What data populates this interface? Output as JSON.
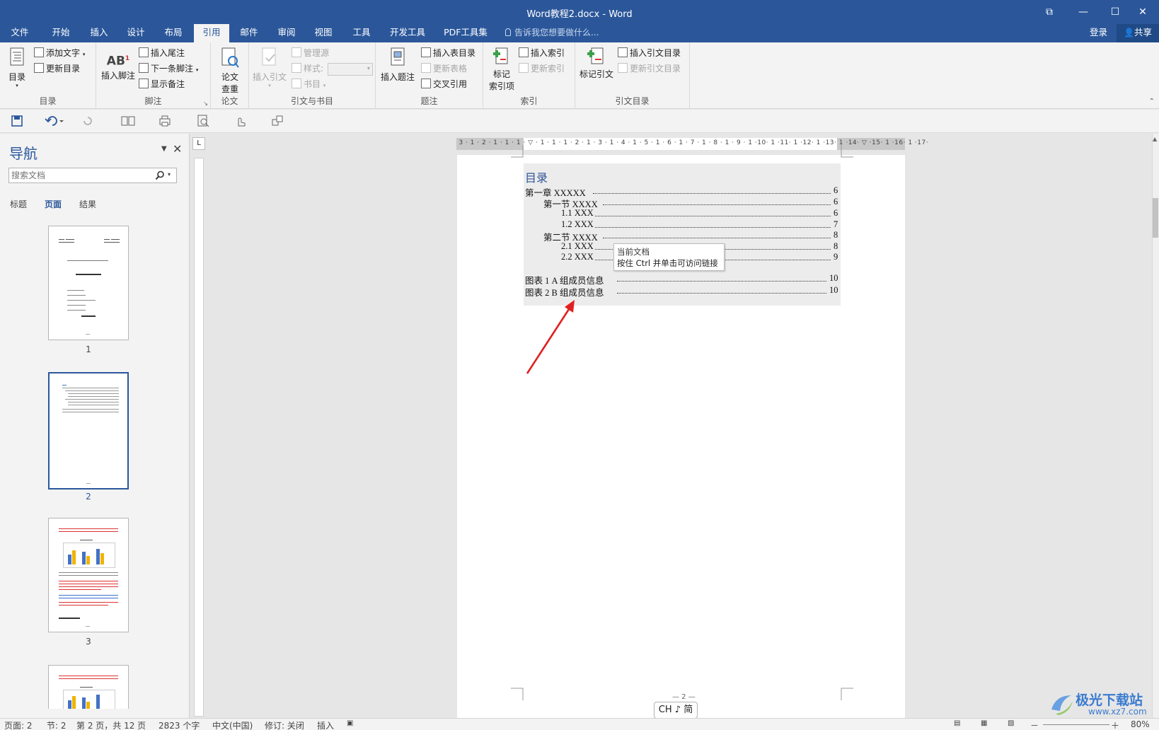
{
  "window": {
    "title": "Word教程2.docx - Word",
    "buttons": {
      "ribbon_display": "⧉",
      "minimize": "—",
      "maximize": "☐",
      "close": "✕"
    }
  },
  "tabs": [
    {
      "label": "文件"
    },
    {
      "label": "开始"
    },
    {
      "label": "插入"
    },
    {
      "label": "设计"
    },
    {
      "label": "布局"
    },
    {
      "label": "引用"
    },
    {
      "label": "邮件"
    },
    {
      "label": "审阅"
    },
    {
      "label": "视图"
    },
    {
      "label": "工具"
    },
    {
      "label": "开发工具"
    },
    {
      "label": "PDF工具集"
    }
  ],
  "active_tab": "引用",
  "tell_me": "告诉我您想要做什么...",
  "login": "登录",
  "share": "共享",
  "ribbon": {
    "toc": {
      "group": "目录",
      "toc_btn": "目录",
      "add_text": "添加文字",
      "update_toc": "更新目录"
    },
    "footnotes": {
      "group": "脚注",
      "insert_footnote": "插入脚注",
      "insert_endnote": "插入尾注",
      "next_footnote": "下一条脚注",
      "show_notes": "显示备注"
    },
    "paper": {
      "group": "论文",
      "check_line1": "论文",
      "check_line2": "查重"
    },
    "citations": {
      "group": "引文与书目",
      "insert_citation": "插入引文",
      "manage_sources": "管理源",
      "style": "样式:",
      "bibliography": "书目"
    },
    "captions": {
      "group": "题注",
      "insert_caption": "插入题注",
      "insert_tof": "插入表目录",
      "update_table": "更新表格",
      "cross_ref": "交叉引用"
    },
    "index": {
      "group": "索引",
      "mark_entry_line1": "标记",
      "mark_entry_line2": "索引项",
      "insert_index": "插入索引",
      "update_index": "更新索引"
    },
    "toa": {
      "group": "引文目录",
      "mark_citation": "标记引文",
      "insert_toa": "插入引文目录",
      "update_toa": "更新引文目录"
    }
  },
  "nav": {
    "title": "导航",
    "search_placeholder": "搜索文档",
    "tabs": [
      "标题",
      "页面",
      "结果"
    ],
    "active_tab": "页面",
    "pages": [
      "1",
      "2",
      "3"
    ]
  },
  "document": {
    "toc_heading": "目录",
    "toc_entries": [
      {
        "text": "第一章  XXXXX",
        "page": "6",
        "level": 0
      },
      {
        "text": "第一节  XXXX",
        "page": "6",
        "level": 1
      },
      {
        "text": "1.1 XXX",
        "page": "6",
        "level": 2
      },
      {
        "text": "1.2 XXX",
        "page": "7",
        "level": 2
      },
      {
        "text": "第二节  XXXX",
        "page": "8",
        "level": 1
      },
      {
        "text": "2.1 XXX",
        "page": "8",
        "level": 2
      },
      {
        "text": "2.2 XXX",
        "page": "9",
        "level": 2
      }
    ],
    "tof_entries": [
      {
        "text": "图表 1    A 组成员信息",
        "page": "10"
      },
      {
        "text": "图表 2    B 组成员信息",
        "page": "10"
      }
    ],
    "tooltip_line1": "当前文档",
    "tooltip_line2": "按住 Ctrl 并单击可访问链接",
    "page_number": "— 2 —",
    "ime": "CH ♪ 简"
  },
  "status": {
    "page": "页面: 2",
    "section": "节: 2",
    "page_of": "第 2 页，共 12 页",
    "words": "2823 个字",
    "language": "中文(中国)",
    "track": "修订: 关闭",
    "insert_mode": "插入",
    "zoom": "80%"
  },
  "watermark": {
    "line1": "极光下载站",
    "line2": "www.xz7.com"
  },
  "colors": {
    "accent": "#2b579a",
    "toc_heading": "#2f5496",
    "arrow": "#e02020"
  }
}
